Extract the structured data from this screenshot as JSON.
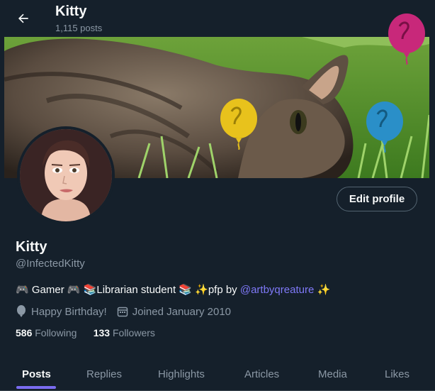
{
  "header": {
    "back_icon": "arrow-left-icon",
    "title": "Kitty",
    "post_count": "1,115 posts"
  },
  "profile": {
    "display_name": "Kitty",
    "handle": "@InfectedKitty",
    "edit_label": "Edit profile",
    "bio": {
      "gamer_prefix": "🎮 Gamer 🎮 ",
      "librarian": "📚Librarian student 📚 ",
      "pfp_text": "✨pfp by ",
      "pfp_link": "@artbyqreature",
      "sparkle_end": " ✨"
    },
    "birthday": "Happy Birthday!",
    "joined": "Joined January 2010",
    "following_count": "586",
    "following_label": "Following",
    "followers_count": "133",
    "followers_label": "Followers"
  },
  "tabs": [
    {
      "label": "Posts",
      "active": true
    },
    {
      "label": "Replies"
    },
    {
      "label": "Highlights"
    },
    {
      "label": "Articles"
    },
    {
      "label": "Media"
    },
    {
      "label": "Likes"
    }
  ],
  "colors": {
    "background": "#15202b",
    "accent": "#7a6cf0",
    "link": "#7f79f8",
    "muted": "#8b98a5"
  }
}
